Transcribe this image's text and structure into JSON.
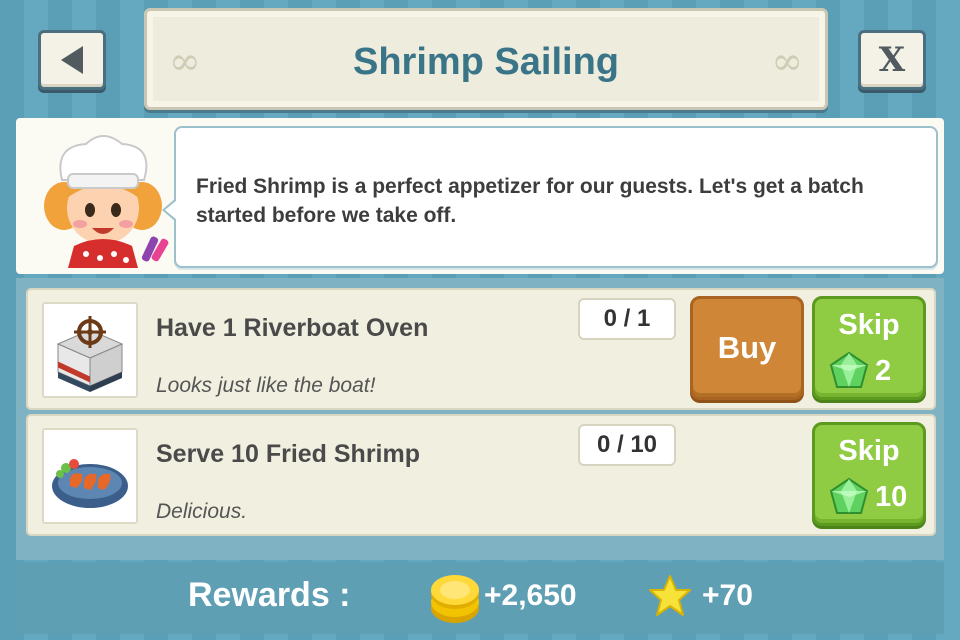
{
  "header": {
    "title": "Shrimp Sailing",
    "back_icon": "back-arrow-icon",
    "close_label": "X"
  },
  "intro": {
    "message": "Fried Shrimp is a perfect appetizer for our guests. Let's get a batch started before we take off."
  },
  "tasks": [
    {
      "title": "Have 1 Riverboat Oven",
      "description": "Looks just like the boat!",
      "progress": "0 / 1",
      "buy_label": "Buy",
      "skip_label": "Skip",
      "skip_cost": "2"
    },
    {
      "title": "Serve 10 Fried Shrimp",
      "description": "Delicious.",
      "progress": "0 / 10",
      "skip_label": "Skip",
      "skip_cost": "10"
    }
  ],
  "rewards": {
    "label": "Rewards :",
    "coins": "+2,650",
    "stars": "+70"
  },
  "colors": {
    "title": "#3a7488",
    "buy": "#cf8636",
    "skip": "#8fcc44",
    "background": "#5a9fb6"
  }
}
